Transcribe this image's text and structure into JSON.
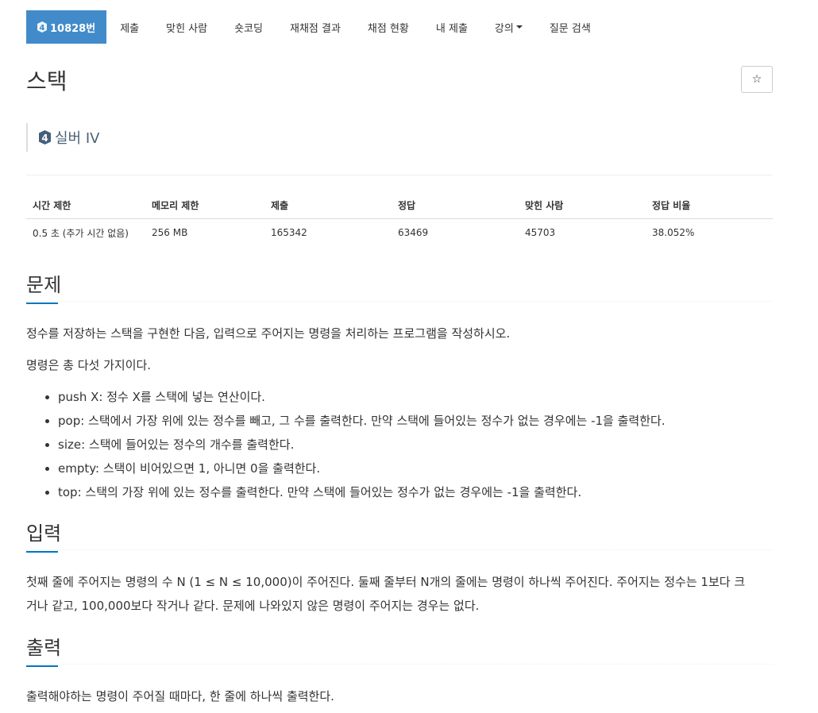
{
  "nav": {
    "problem_tab": "10828번",
    "tier_number": "4",
    "tabs": [
      "제출",
      "맞힌 사람",
      "숏코딩",
      "재채점 결과",
      "채점 현황",
      "내 제출",
      "강의",
      "질문 검색"
    ]
  },
  "title": "스택",
  "tier": {
    "number": "4",
    "label": "실버 IV"
  },
  "star": "☆",
  "table": {
    "headers": [
      "시간 제한",
      "메모리 제한",
      "제출",
      "정답",
      "맞힌 사람",
      "정답 비율"
    ],
    "row": [
      "0.5 초 (추가 시간 없음)",
      "256 MB",
      "165342",
      "63469",
      "45703",
      "38.052%"
    ]
  },
  "sections": {
    "problem": {
      "title": "문제",
      "p1": "정수를 저장하는 스택을 구현한 다음, 입력으로 주어지는 명령을 처리하는 프로그램을 작성하시오.",
      "p2": "명령은 총 다섯 가지이다.",
      "items": [
        "push X: 정수 X를 스택에 넣는 연산이다.",
        "pop: 스택에서 가장 위에 있는 정수를 빼고, 그 수를 출력한다. 만약 스택에 들어있는 정수가 없는 경우에는 -1을 출력한다.",
        "size: 스택에 들어있는 정수의 개수를 출력한다.",
        "empty: 스택이 비어있으면 1, 아니면 0을 출력한다.",
        "top: 스택의 가장 위에 있는 정수를 출력한다. 만약 스택에 들어있는 정수가 없는 경우에는 -1을 출력한다."
      ]
    },
    "input": {
      "title": "입력",
      "line1": "첫째 줄에 주어지는 명령의 수 N (1 ≤ N ≤ 10,000)이 주어진다. 둘째 줄부터 N개의 줄에는 명령이 하나씩 주어진다. 주어지는 정수는 1보다 크",
      "line2": "거나 같고, 100,000보다 작거나 같다. 문제에 나와있지 않은 명령이 주어지는 경우는 없다."
    },
    "output": {
      "title": "출력",
      "p": "출력해야하는 명령이 주어질 때마다, 한 줄에 하나씩 출력한다."
    }
  },
  "colors": {
    "accent": "#428bca",
    "section_underline": "#0076c0",
    "tier_silver": "#435f7a"
  }
}
